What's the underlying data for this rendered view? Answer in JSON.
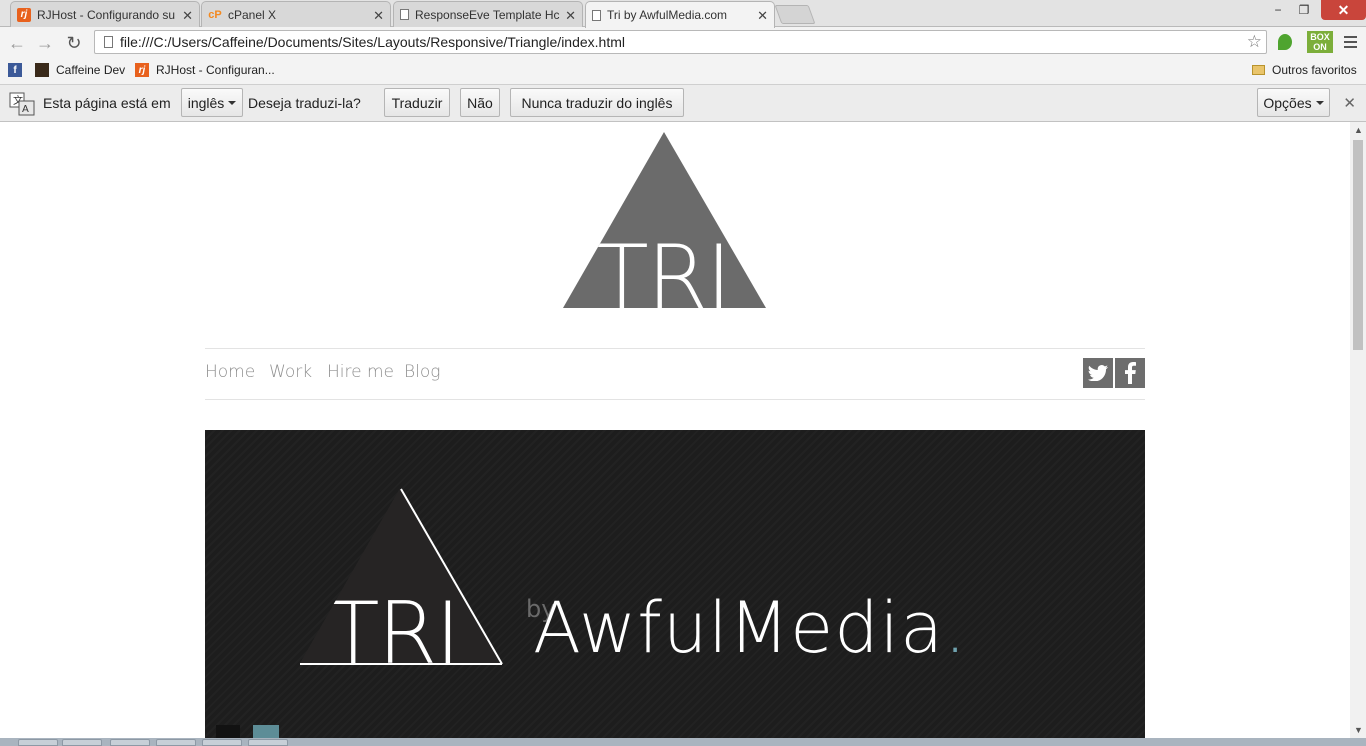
{
  "browser": {
    "tabs": [
      {
        "title": "RJHost - Configurando su",
        "icon": "rjhost-favicon"
      },
      {
        "title": "cPanel X",
        "icon": "cpanel-favicon"
      },
      {
        "title": "ResponseEve Template Hc",
        "icon": "document-favicon"
      },
      {
        "title": "Tri by AwfulMedia.com",
        "icon": "document-favicon",
        "active": true
      }
    ],
    "window_controls": {
      "minimize": "−",
      "restore": "❐",
      "close": "✕"
    },
    "address": "file:///C:/Users/Caffeine/Documents/Sites/Layouts/Responsive/Triangle/index.html",
    "extension_box_label": "BOX ON"
  },
  "bookmarks": {
    "items": [
      {
        "label": "",
        "icon": "facebook-icon"
      },
      {
        "label": "Caffeine Dev",
        "icon": "caffeine-icon"
      },
      {
        "label": "RJHost - Configuran...",
        "icon": "rjhost-icon"
      }
    ],
    "other": "Outros favoritos"
  },
  "translate_bar": {
    "prefix": "Esta página está em",
    "language": "inglês",
    "question": "Deseja traduzi-la?",
    "translate": "Traduzir",
    "no": "Não",
    "never": "Nunca traduzir do inglês",
    "options": "Opções"
  },
  "site": {
    "logo_text": "TRI",
    "nav": [
      "Home",
      "Work",
      "Hire me",
      "Blog"
    ],
    "social": [
      {
        "icon": "twitter-icon",
        "glyph": "t"
      },
      {
        "icon": "facebook-icon",
        "glyph": "f"
      }
    ],
    "hero": {
      "logo_text": "TRI",
      "by": "by",
      "brand": "AwfulMedia",
      "dot": "."
    }
  },
  "colors": {
    "logo_gray": "#6b6b6b",
    "hero_bg": "#1d1d1d",
    "accent_teal": "#6fa2ae"
  }
}
